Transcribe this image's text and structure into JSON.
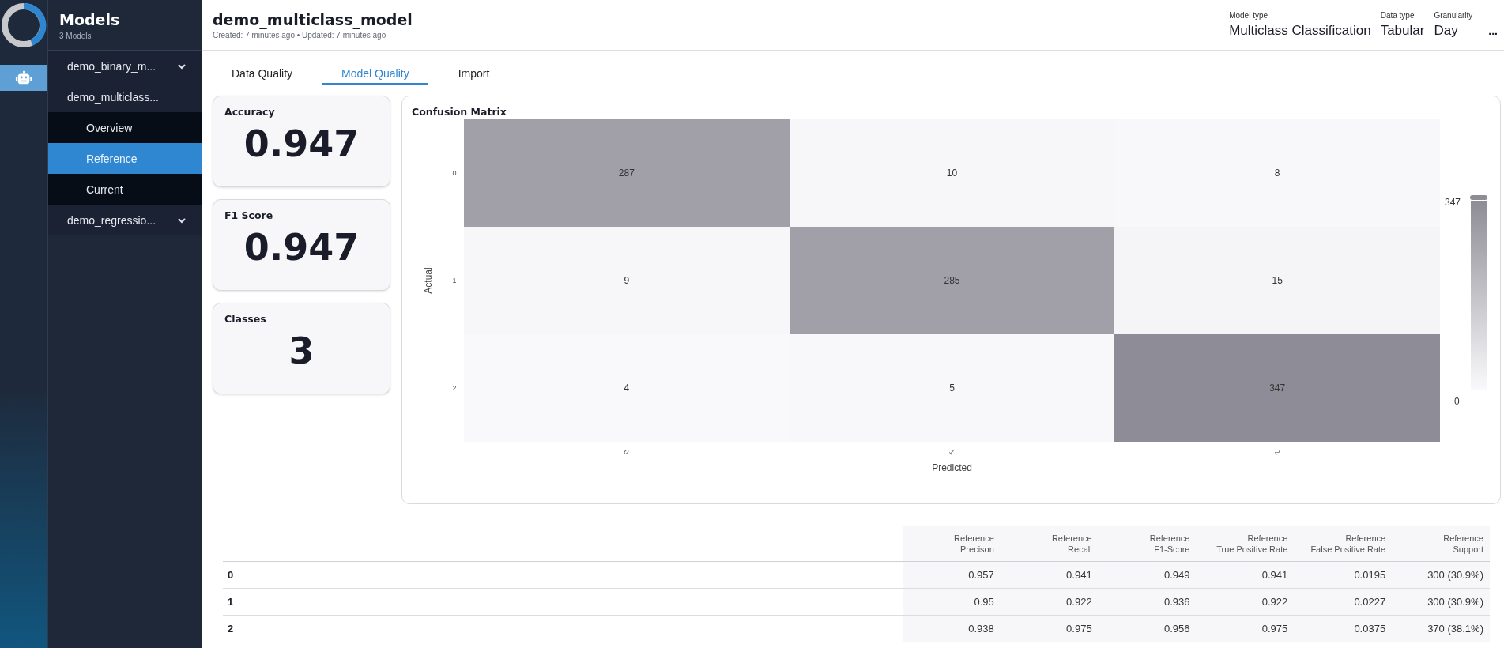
{
  "rail": {
    "items": [
      {
        "kind": "robot",
        "selected": true
      }
    ]
  },
  "sidebar": {
    "title": "Models",
    "subtitle": "3 Models",
    "items": [
      {
        "label": "demo_binary_m...",
        "expanded": false,
        "selected": false
      },
      {
        "label": "demo_multiclass...",
        "expanded": true,
        "selected": false,
        "children": [
          {
            "label": "Overview",
            "selected": false
          },
          {
            "label": "Reference",
            "selected": true
          },
          {
            "label": "Current",
            "selected": false
          }
        ]
      },
      {
        "label": "demo_regressio...",
        "expanded": false,
        "selected": false
      }
    ]
  },
  "header": {
    "title": "demo_multiclass_model",
    "subtitle": "Created: 7 minutes ago • Updated: 7 minutes ago",
    "meta": [
      {
        "label": "Model type",
        "value": "Multiclass Classification"
      },
      {
        "label": "Data type",
        "value": "Tabular"
      },
      {
        "label": "Granularity",
        "value": "Day"
      }
    ],
    "more": "..."
  },
  "tabs": [
    {
      "label": "Data Quality",
      "selected": false
    },
    {
      "label": "Model Quality",
      "selected": true
    },
    {
      "label": "Import",
      "selected": false
    }
  ],
  "metrics": [
    {
      "label": "Accuracy",
      "value": "0.947"
    },
    {
      "label": "F1 Score",
      "value": "0.947"
    },
    {
      "label": "Classes",
      "value": "3"
    }
  ],
  "confusion_matrix": {
    "title": "Confusion Matrix",
    "y_label": "Actual",
    "x_label": "Predicted",
    "row_labels": [
      "0",
      "1",
      "2"
    ],
    "col_labels": [
      "0",
      "1",
      "2"
    ],
    "cells": [
      [
        "287",
        "10",
        "8"
      ],
      [
        "9",
        "285",
        "15"
      ],
      [
        "4",
        "5",
        "347"
      ]
    ],
    "scale_max": "347",
    "scale_min": "0"
  },
  "table": {
    "columns": [
      "Reference\nPrecison",
      "Reference\nRecall",
      "Reference\nF1-Score",
      "Reference\nTrue Positive Rate",
      "Reference\nFalse Positive Rate",
      "Reference\nSupport"
    ],
    "rows": [
      {
        "label": "0",
        "cells": [
          "0.957",
          "0.941",
          "0.949",
          "0.941",
          "0.0195",
          "300 (30.9%)"
        ]
      },
      {
        "label": "1",
        "cells": [
          "0.95",
          "0.922",
          "0.936",
          "0.922",
          "0.0227",
          "300 (30.9%)"
        ]
      },
      {
        "label": "2",
        "cells": [
          "0.938",
          "0.975",
          "0.956",
          "0.975",
          "0.0375",
          "370 (38.1%)"
        ]
      }
    ]
  }
}
